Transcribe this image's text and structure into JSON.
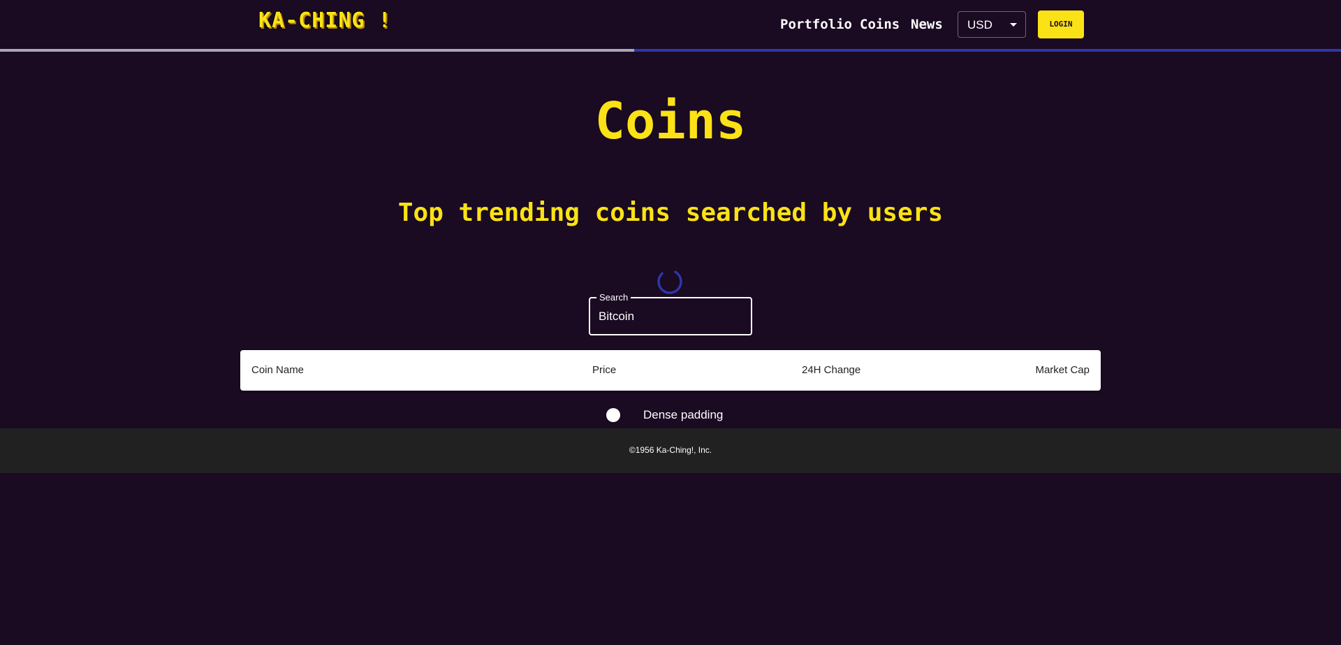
{
  "header": {
    "logo": "KA-CHING !",
    "nav": {
      "portfolio": "Portfolio",
      "coins": "Coins",
      "news": "News"
    },
    "currency": {
      "selected": "USD"
    },
    "login_label": "LOGIN"
  },
  "progress": {
    "fraction": 0.473
  },
  "main": {
    "title": "Coins",
    "subtitle": "Top trending coins searched by users"
  },
  "search": {
    "label": "Search",
    "value": "Bitcoin"
  },
  "table": {
    "columns": [
      "Coin Name",
      "Price",
      "24H Change",
      "Market Cap"
    ]
  },
  "dense_padding": {
    "label": "Dense padding",
    "checked": false
  },
  "footer": {
    "text": "©1956 Ka-Ching!, Inc."
  },
  "colors": {
    "background": "#1a0a22",
    "accent": "#fbe216",
    "progress": "#2e36a8",
    "footer": "#212121"
  }
}
